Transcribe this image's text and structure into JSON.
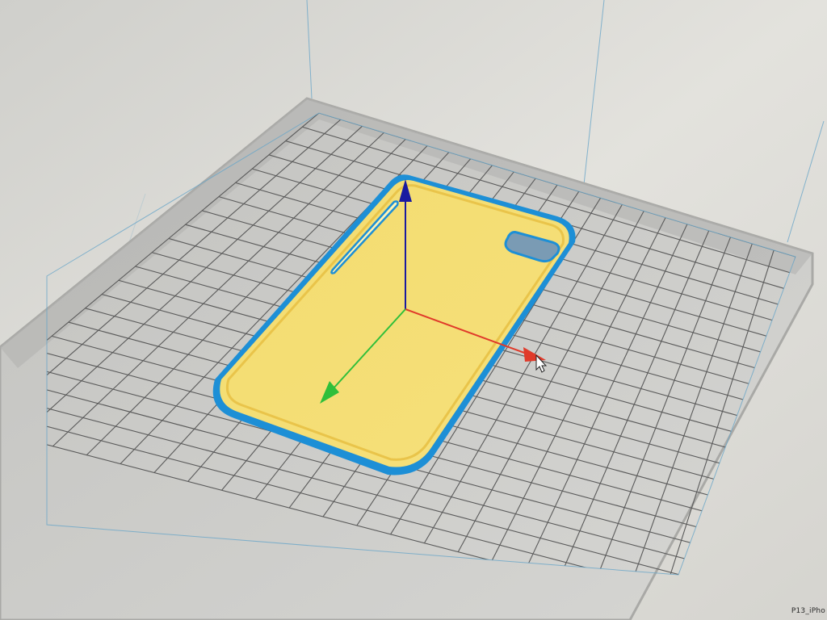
{
  "viewport": {
    "model_file_label": "P13_iPho",
    "colors": {
      "background": "#d8d7d2",
      "build_plate": "#c9c9c6",
      "grid_line": "#5a5a5a",
      "plate_border": "#a9a9a6",
      "model_fill": "#f2d66a",
      "model_outline": "#1d8fd6",
      "axis_x": "#e03a2a",
      "axis_y": "#2fbf3a",
      "axis_z": "#1a1aa0",
      "bounding_line": "#6aa6c8"
    },
    "icons": {
      "gizmo": "move-gizmo-icon",
      "cursor": "mouse-pointer-icon"
    }
  }
}
